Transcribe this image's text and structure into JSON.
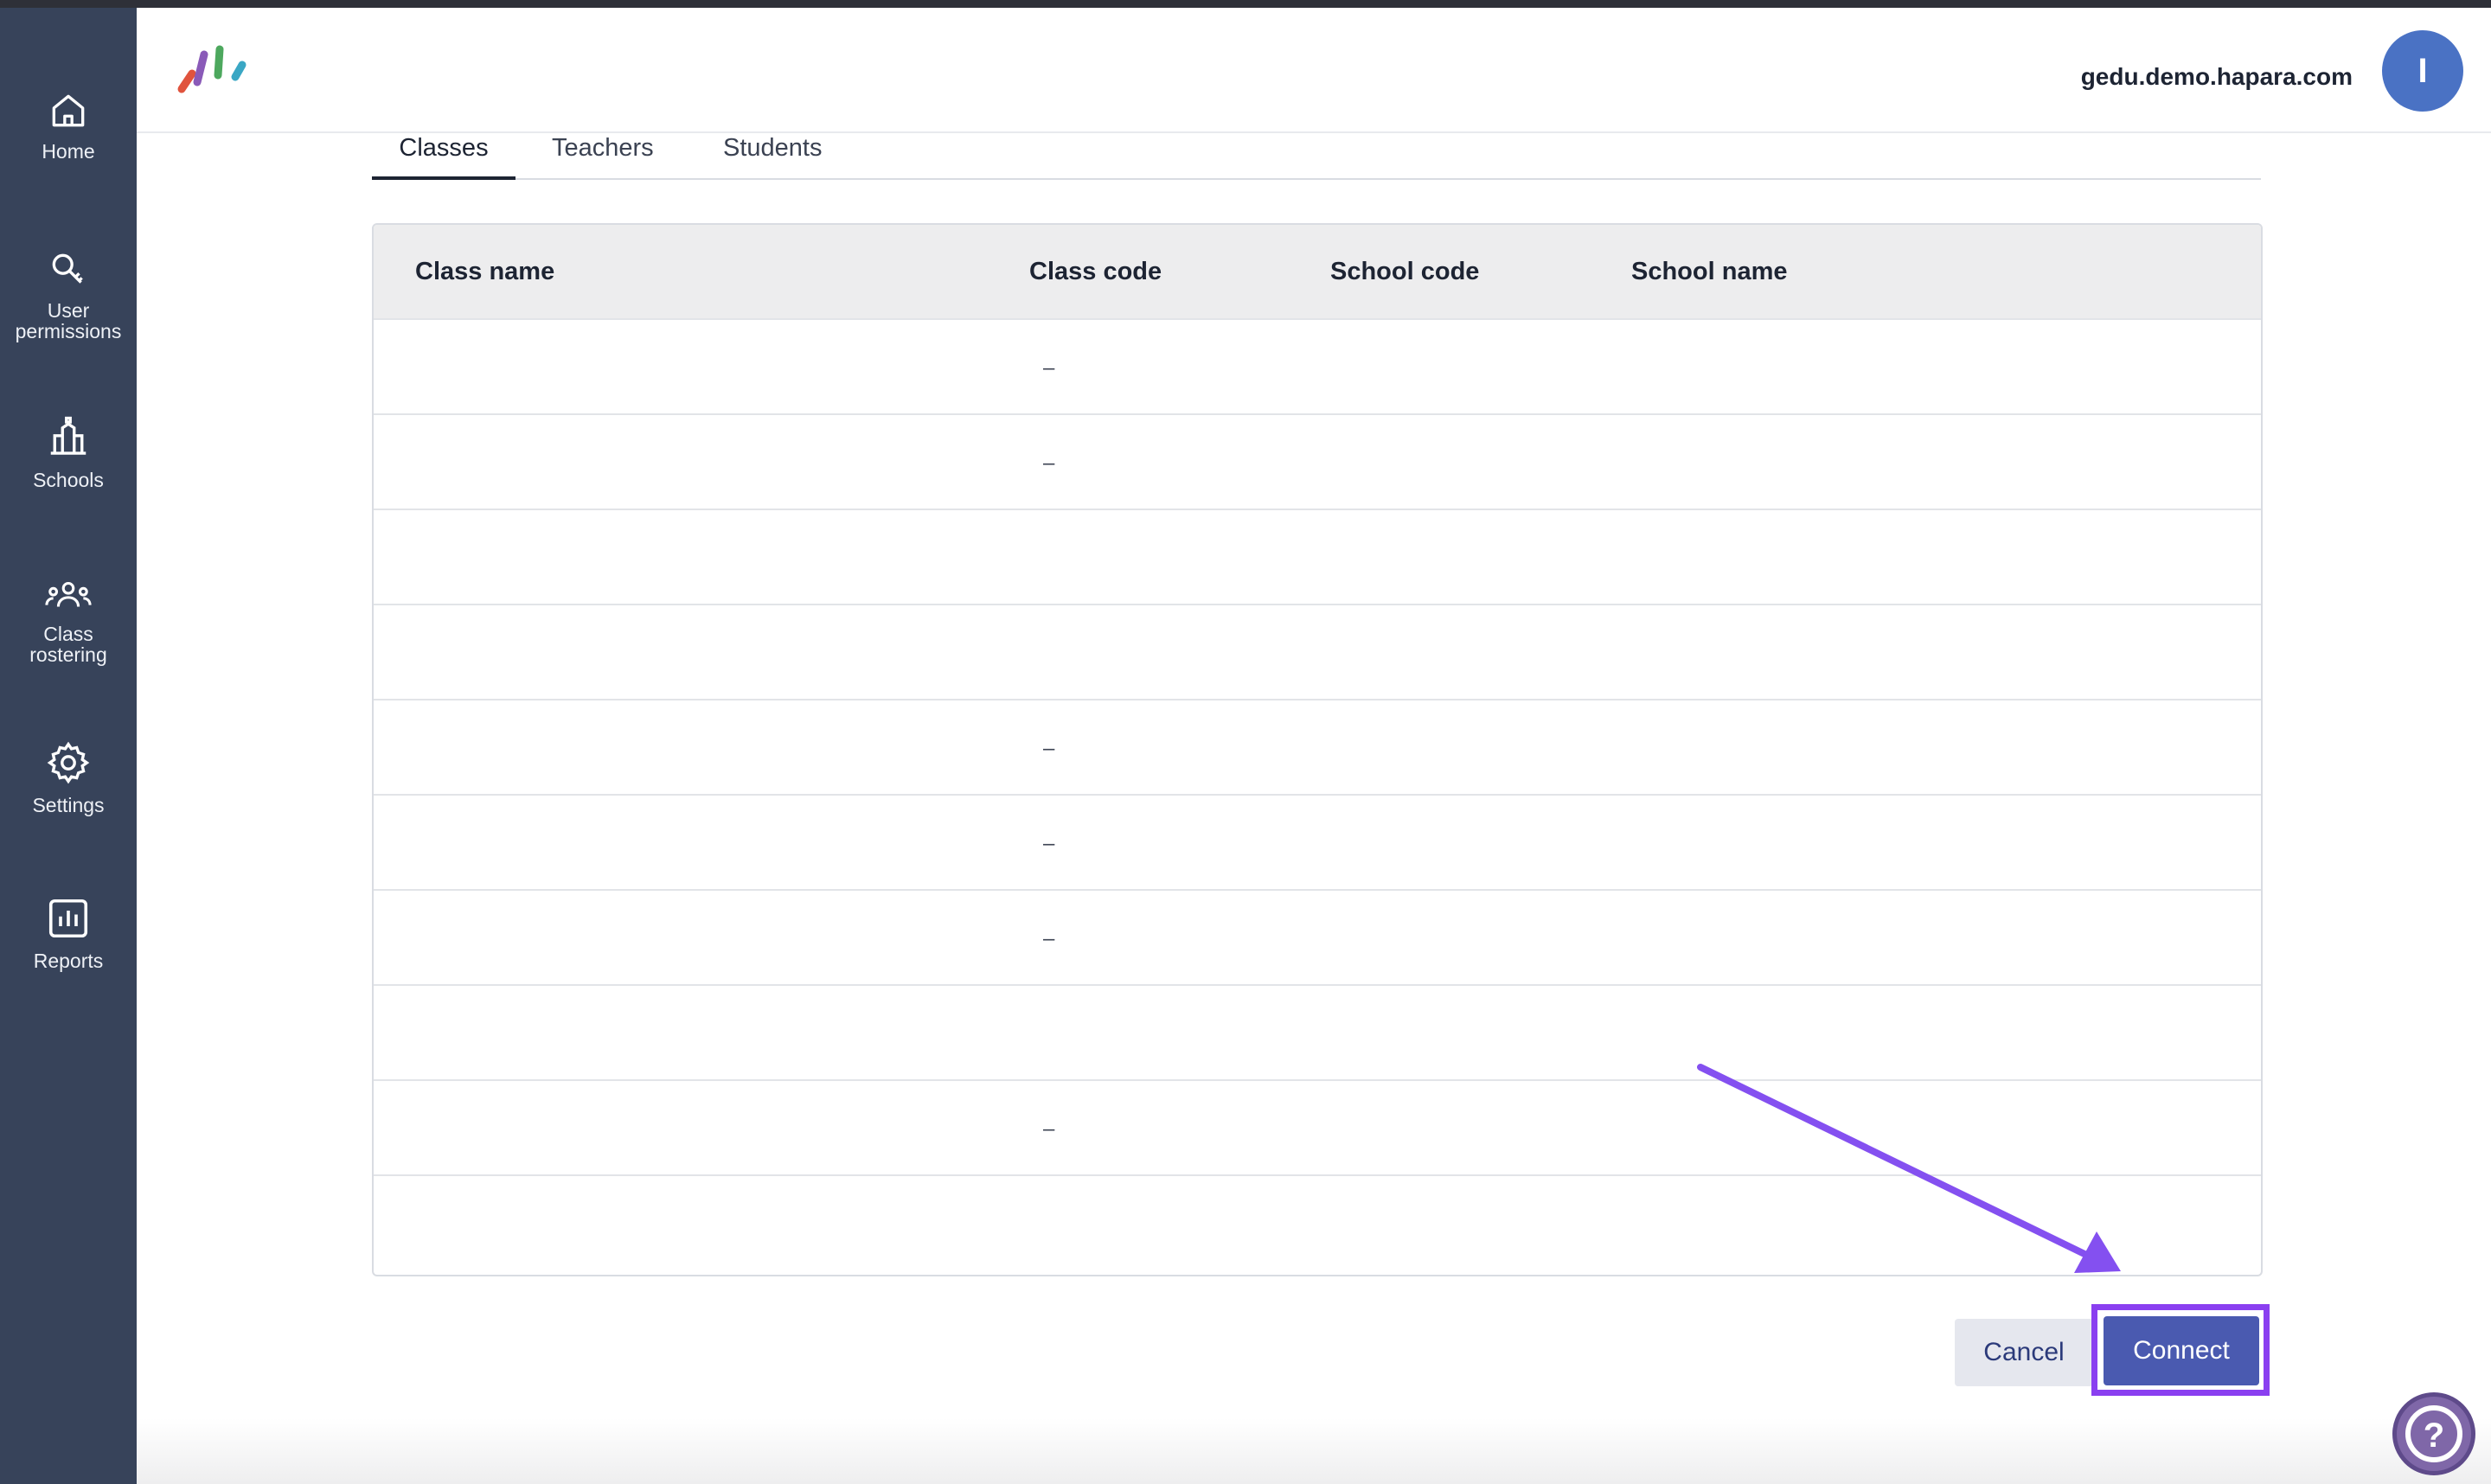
{
  "header": {
    "domain": "gedu.demo.hapara.com",
    "avatar_initial": "I"
  },
  "sidebar": {
    "items": [
      {
        "label": "Home",
        "icon": "home-icon"
      },
      {
        "label": "User\npermissions",
        "icon": "key-icon"
      },
      {
        "label": "Schools",
        "icon": "school-icon"
      },
      {
        "label": "Class\nrostering",
        "icon": "users-icon"
      },
      {
        "label": "Settings",
        "icon": "gear-icon"
      },
      {
        "label": "Reports",
        "icon": "chart-icon"
      }
    ]
  },
  "tabs": [
    {
      "label": "Classes",
      "active": true
    },
    {
      "label": "Teachers",
      "active": false
    },
    {
      "label": "Students",
      "active": false
    }
  ],
  "table": {
    "columns": [
      "Class name",
      "Class code",
      "School code",
      "School name"
    ],
    "rows": [
      {
        "class_code": "–"
      },
      {
        "class_code": "–"
      },
      {
        "class_code": ""
      },
      {
        "class_code": ""
      },
      {
        "class_code": "–"
      },
      {
        "class_code": "–"
      },
      {
        "class_code": "–"
      },
      {
        "class_code": ""
      },
      {
        "class_code": "–"
      },
      {
        "class_code": ""
      }
    ]
  },
  "actions": {
    "cancel_label": "Cancel",
    "connect_label": "Connect"
  },
  "help": {
    "label": "?"
  },
  "colors": {
    "sidebar": "#37435a",
    "accent": "#4a5ab0",
    "highlight": "#8a3ff0",
    "avatar": "#4a72c4"
  }
}
